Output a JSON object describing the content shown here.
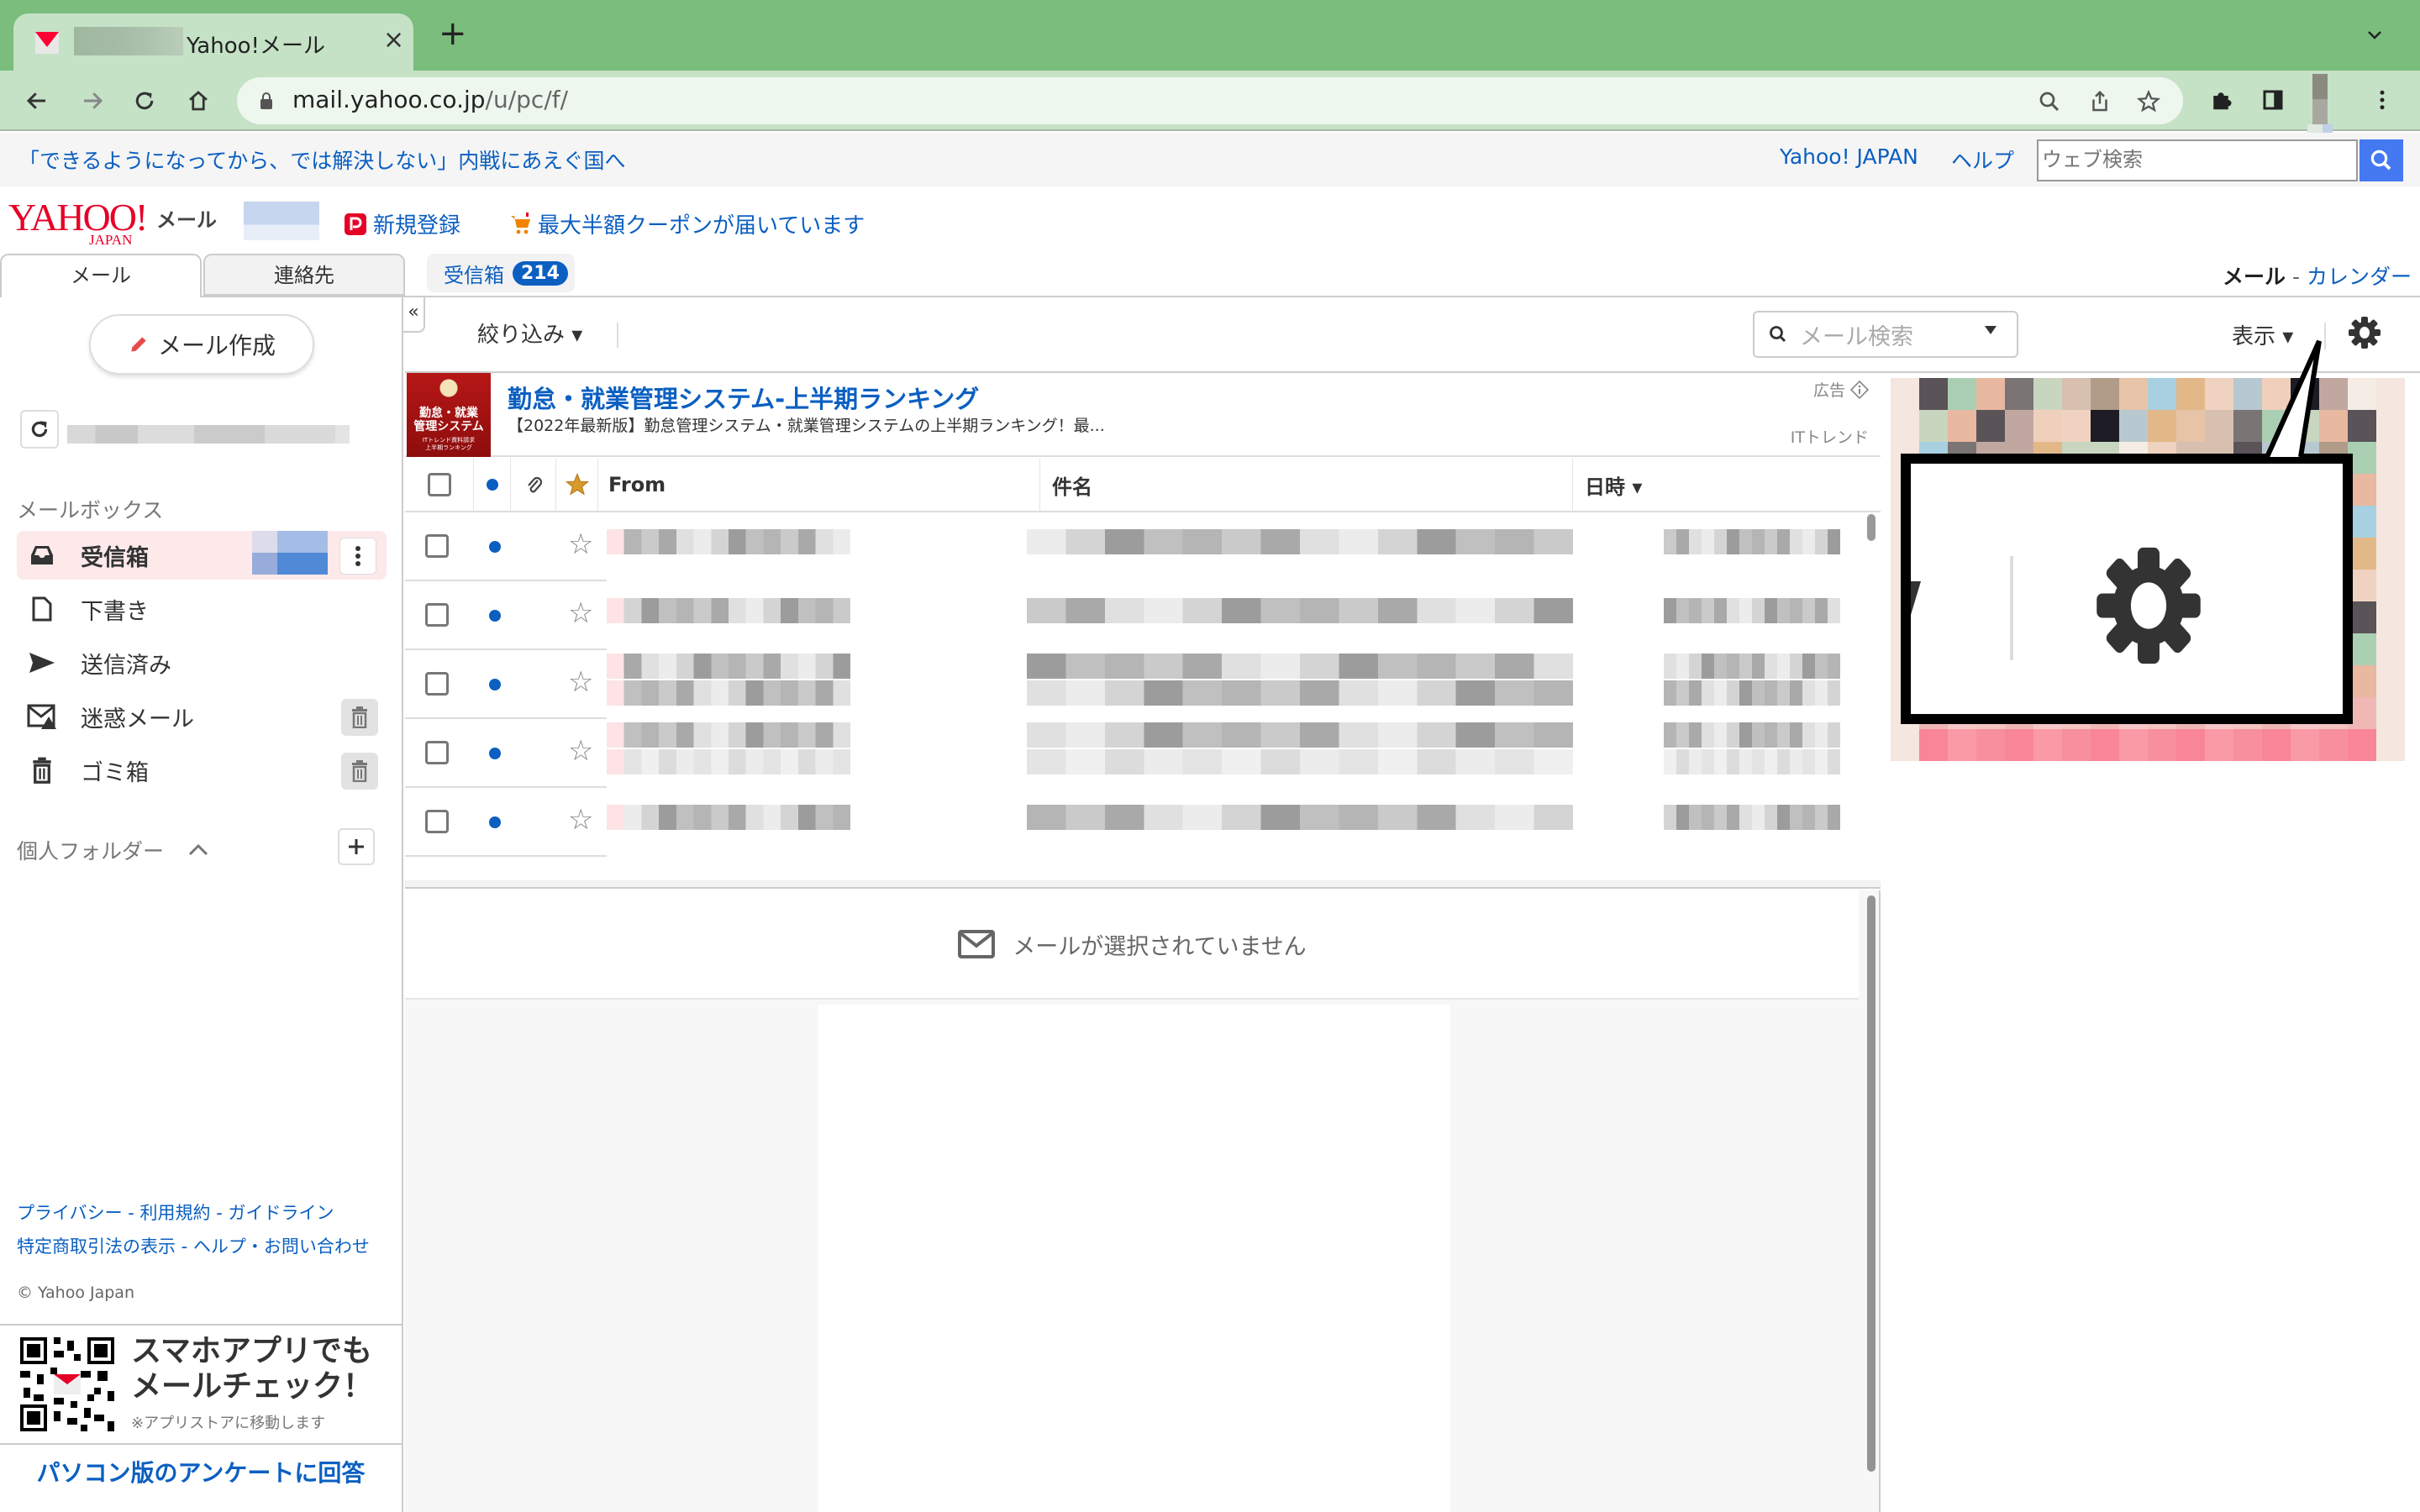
{
  "browser": {
    "tab_title": "Yahoo!メール",
    "close_label": "×",
    "new_tab_label": "+",
    "url_host": "mail.yahoo.co.jp",
    "url_path": "/u/pc/f/"
  },
  "topbar": {
    "news_headline": "「できるようになってから、では解決しない」内戦にあえぐ国へ",
    "yahoo_japan_link": "Yahoo! JAPAN",
    "help_link": "ヘルプ",
    "web_search_placeholder": "ウェブ検索"
  },
  "header": {
    "logo_text": "YAHOO!",
    "logo_sub": "JAPAN",
    "service_name": "メール",
    "signup_link": "新規登録",
    "coupon_link": "最大半額クーポンが届いています"
  },
  "tabs": {
    "mail": "メール",
    "contacts": "連絡先",
    "inbox_chip": "受信箱",
    "inbox_count": "214",
    "current_app": "メール",
    "separator": " - ",
    "calendar_link": "カレンダー"
  },
  "sidebar": {
    "compose_label": "メール作成",
    "mailbox_title": "メールボックス",
    "folders": [
      {
        "label": "受信箱",
        "icon": "inbox-icon",
        "active": true
      },
      {
        "label": "下書き",
        "icon": "draft-icon"
      },
      {
        "label": "送信済み",
        "icon": "sent-icon"
      },
      {
        "label": "迷惑メール",
        "icon": "spam-icon",
        "action": "empty-trash"
      },
      {
        "label": "ゴミ箱",
        "icon": "trash-icon",
        "action": "empty-trash"
      }
    ],
    "personal_folders_title": "個人フォルダー",
    "footer_links": {
      "privacy": "プライバシー",
      "terms": "利用規約",
      "guidelines": "ガイドライン",
      "commerce": "特定商取引法の表示",
      "help_contact": "ヘルプ・お問い合わせ",
      "dash": " - "
    },
    "copyright": "© Yahoo Japan",
    "app_promo_line1": "スマホアプリでも",
    "app_promo_line2": "メールチェック！",
    "app_promo_note": "※アプリストアに移動します",
    "survey_link": "パソコン版のアンケートに回答"
  },
  "toolbar": {
    "collapse_label": "«",
    "filter_label": "絞り込み ▾",
    "search_placeholder": "メール検索",
    "view_label": "表示 ▾"
  },
  "ad": {
    "image_line1": "勤怠・就業",
    "image_line2": "管理システム",
    "image_line3": "ITトレンド資料請求",
    "image_line4": "上半期ランキング",
    "title": "勤怠・就業管理システム-上半期ランキング",
    "description": "【2022年最新版】勤怠管理システム・就業管理システムの上半期ランキング！最...",
    "label": "広告",
    "source": "ITトレンド"
  },
  "list": {
    "columns": {
      "from": "From",
      "subject": "件名",
      "date": "日時 ▾"
    },
    "rows": [
      {
        "unread": true,
        "starred": false,
        "content": "redacted"
      },
      {
        "unread": true,
        "starred": false,
        "content": "redacted"
      },
      {
        "unread": true,
        "starred": false,
        "content": "redacted"
      },
      {
        "unread": true,
        "starred": false,
        "content": "redacted"
      },
      {
        "unread": true,
        "starred": false,
        "content": "redacted"
      }
    ]
  },
  "preview": {
    "empty_message": "メールが選択されていません"
  },
  "colors": {
    "brand_red": "#e60027",
    "link_blue": "#0b5fc1",
    "browser_frame": "#7abd7c",
    "active_folder_bg": "#fde9ea"
  }
}
